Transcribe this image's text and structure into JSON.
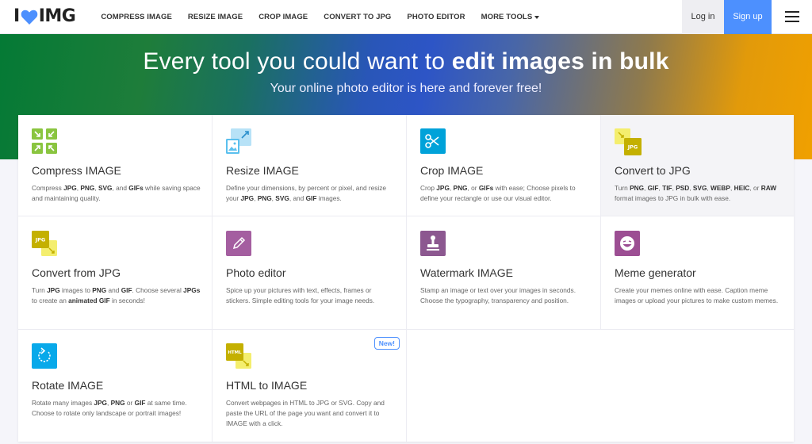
{
  "header": {
    "logo_left": "I",
    "logo_right": "IMG",
    "nav": [
      {
        "label": "COMPRESS IMAGE"
      },
      {
        "label": "RESIZE IMAGE"
      },
      {
        "label": "CROP IMAGE"
      },
      {
        "label": "CONVERT TO JPG"
      },
      {
        "label": "PHOTO EDITOR"
      },
      {
        "label": "MORE TOOLS"
      }
    ],
    "login_label": "Log in",
    "signup_label": "Sign up"
  },
  "hero": {
    "title_plain": "Every tool you could want to ",
    "title_bold": "edit images in bulk",
    "subtitle": "Your online photo editor is here and forever free!"
  },
  "colors": {
    "accent_blue": "#4d90fe",
    "compress_green": "#8ac540",
    "resize_blue": "#7fcdf2",
    "crop_blue": "#00a2d9",
    "jpg_yellow": "#c4b000",
    "editor_purple": "#a45ea0",
    "watermark_purple": "#8c5890",
    "meme_purple": "#9c4e93",
    "rotate_blue": "#08a9ea"
  },
  "tools": [
    {
      "icon": "compress-icon",
      "title": "Compress IMAGE",
      "desc": [
        {
          "t": "Compress "
        },
        {
          "b": "JPG"
        },
        {
          "t": ", "
        },
        {
          "b": "PNG"
        },
        {
          "t": ", "
        },
        {
          "b": "SVG"
        },
        {
          "t": ", and "
        },
        {
          "b": "GIFs"
        },
        {
          "t": " while saving space and maintaining quality."
        }
      ]
    },
    {
      "icon": "resize-icon",
      "title": "Resize IMAGE",
      "desc": [
        {
          "t": "Define your dimensions, by percent or pixel, and resize your "
        },
        {
          "b": "JPG"
        },
        {
          "t": ", "
        },
        {
          "b": "PNG"
        },
        {
          "t": ", "
        },
        {
          "b": "SVG"
        },
        {
          "t": ", and "
        },
        {
          "b": "GIF"
        },
        {
          "t": " images."
        }
      ]
    },
    {
      "icon": "crop-icon",
      "title": "Crop IMAGE",
      "desc": [
        {
          "t": "Crop "
        },
        {
          "b": "JPG"
        },
        {
          "t": ", "
        },
        {
          "b": "PNG"
        },
        {
          "t": ", or "
        },
        {
          "b": "GIFs"
        },
        {
          "t": " with ease; Choose pixels to define your rectangle or use our visual editor."
        }
      ]
    },
    {
      "icon": "convert-to-jpg-icon",
      "title": "Convert to JPG",
      "desc": [
        {
          "t": "Turn "
        },
        {
          "b": "PNG"
        },
        {
          "t": ", "
        },
        {
          "b": "GIF"
        },
        {
          "t": ", "
        },
        {
          "b": "TIF"
        },
        {
          "t": ", "
        },
        {
          "b": "PSD"
        },
        {
          "t": ", "
        },
        {
          "b": "SVG"
        },
        {
          "t": ", "
        },
        {
          "b": "WEBP"
        },
        {
          "t": ", "
        },
        {
          "b": "HEIC"
        },
        {
          "t": ", or "
        },
        {
          "b": "RAW"
        },
        {
          "t": " format images to JPG in bulk with ease."
        }
      ]
    },
    {
      "icon": "convert-from-jpg-icon",
      "title": "Convert from JPG",
      "desc": [
        {
          "t": "Turn "
        },
        {
          "b": "JPG"
        },
        {
          "t": " images to "
        },
        {
          "b": "PNG"
        },
        {
          "t": " and "
        },
        {
          "b": "GIF"
        },
        {
          "t": ". Choose several "
        },
        {
          "b": "JPGs"
        },
        {
          "t": " to create an "
        },
        {
          "b": "animated GIF"
        },
        {
          "t": " in seconds!"
        }
      ]
    },
    {
      "icon": "pencil-icon",
      "title": "Photo editor",
      "desc": [
        {
          "t": "Spice up your pictures with text, effects, frames or stickers. Simple editing tools for your image needs."
        }
      ]
    },
    {
      "icon": "stamp-icon",
      "title": "Watermark IMAGE",
      "desc": [
        {
          "t": "Stamp an image or text over your images in seconds. Choose the typography, transparency and position."
        }
      ]
    },
    {
      "icon": "meme-face-icon",
      "title": "Meme generator",
      "desc": [
        {
          "t": "Create your memes online with ease. Caption meme images or upload your pictures to make custom memes."
        }
      ]
    },
    {
      "icon": "rotate-icon",
      "title": "Rotate IMAGE",
      "desc": [
        {
          "t": "Rotate many images "
        },
        {
          "b": "JPG"
        },
        {
          "t": ", "
        },
        {
          "b": "PNG"
        },
        {
          "t": " or "
        },
        {
          "b": "GIF"
        },
        {
          "t": " at same time. Choose to rotate only landscape or portrait images!"
        }
      ]
    },
    {
      "icon": "html-to-image-icon",
      "title": "HTML to IMAGE",
      "badge": "New!",
      "desc": [
        {
          "t": "Convert webpages in HTML to JPG or SVG. Copy and paste the URL of the page you want and convert it to IMAGE with a click."
        }
      ]
    }
  ],
  "icon_labels": {
    "jpg": "JPG",
    "html": "HTML"
  }
}
